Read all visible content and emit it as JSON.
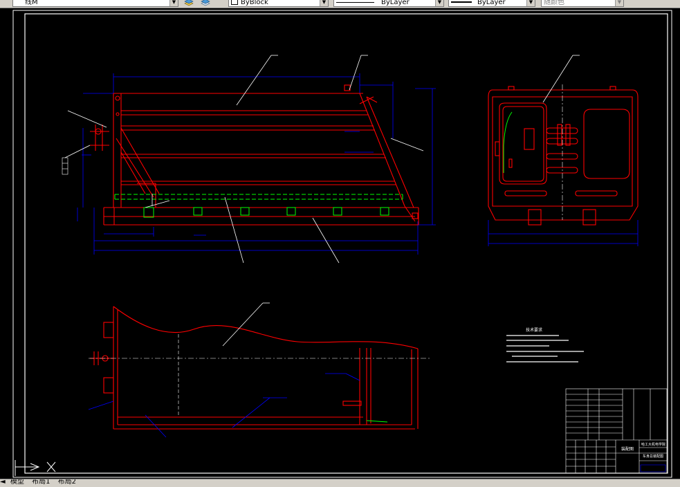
{
  "toolbar": {
    "layer_name": "线M",
    "color_control": "ByBlock",
    "linetype_control": "ByLayer",
    "lineweight_control": "ByLayer",
    "plotstyle_control": "随颜色",
    "layer_icon": "layer-state-icon",
    "layer_prev_icon": "layer-previous-icon"
  },
  "notes": {
    "title": "技术要求"
  },
  "title_block": {
    "company": "哈工大机电学院",
    "drawing_name": "车身总装配图",
    "material": "装配图"
  },
  "tabs": {
    "model": "模型",
    "layout1": "布局1",
    "layout2": "布局2"
  },
  "colors": {
    "background": "#000000",
    "frame": "#ffffff",
    "part": "#ff0000",
    "dimension": "#0000ff",
    "hidden": "#00ff00",
    "leader": "#ffffff"
  }
}
